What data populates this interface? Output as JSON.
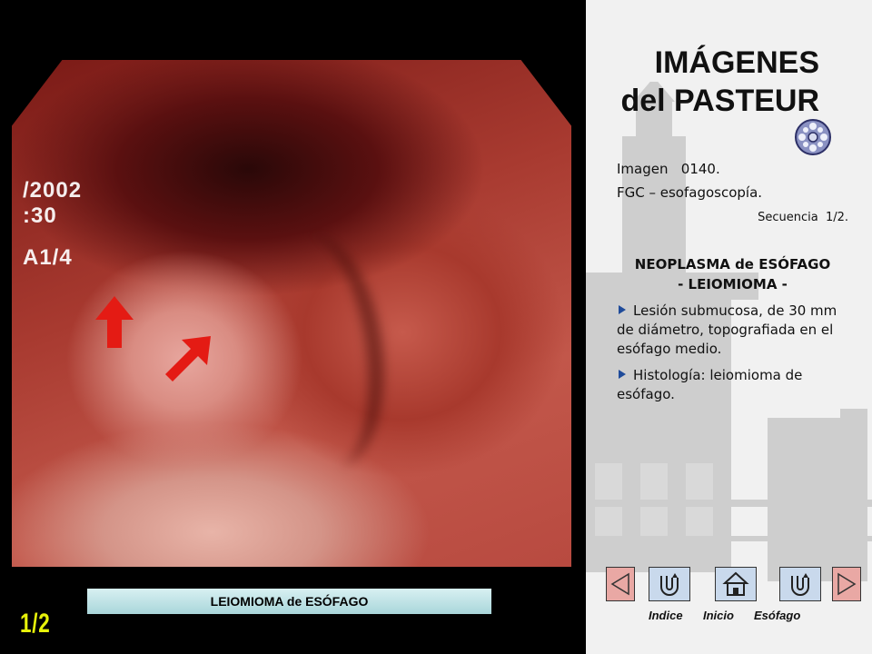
{
  "header": {
    "title_line1": "IMÁGENES",
    "title_line2": "del PASTEUR"
  },
  "info": {
    "image_number": "Imagen   0140.",
    "exam": "FGC – esofagoscopía.",
    "sequence": "Secuencia  1/2.",
    "diagnosis_line1": "NEOPLASMA de ESÓFAGO",
    "diagnosis_line2": "- LEIOMIOMA -",
    "bullets": [
      "Lesión submucosa, de 30 mm de diámetro, topografiada en el esófago medio.",
      "Histología: leiomioma de esófago."
    ]
  },
  "endoscopy": {
    "overlay_line1": "/2002",
    "overlay_line2": ":30",
    "overlay_line3": "A1/4",
    "caption": "LEIOMIOMA  de ESÓFAGO",
    "arrow_color": "#e41b14"
  },
  "page_indicator": "1/2",
  "nav": {
    "index_label": "Indice",
    "home_label": "Inicio",
    "esophagus_label": "Esófago"
  },
  "icons": {
    "prev": "triangle-left-icon",
    "index": "u-turn-icon",
    "home": "house-icon",
    "esophagus": "u-turn-icon",
    "next": "triangle-right-icon",
    "film": "film-reel-icon"
  },
  "colors": {
    "accent_red": "#e41b14",
    "page_indicator": "#e7f20a",
    "caption_bg": "#bfe3e6",
    "bullet": "#1f4b9a"
  }
}
